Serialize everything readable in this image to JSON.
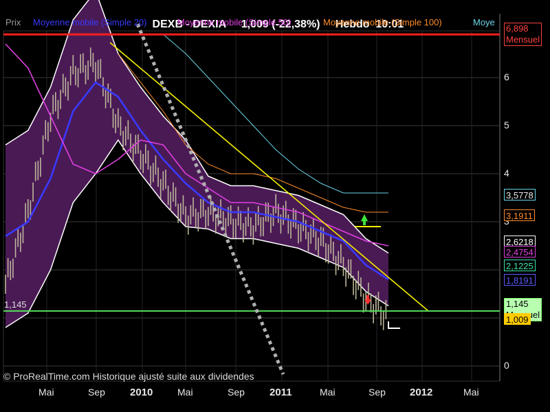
{
  "title": {
    "symbol": "DEXB - DEXIA",
    "price": "1,009 (-22,38%)",
    "period": "Hebdo",
    "time": "10:01"
  },
  "legend": [
    {
      "label": "Prix",
      "color": "#9a9a9a"
    },
    {
      "label": "Moyenne mobile (Simple 20)",
      "color": "#3a3aff"
    },
    {
      "label": "Moyenne mobile (Simple 50)",
      "color": "#e040e0"
    },
    {
      "label": "Moyenne mobile (Simple 100)",
      "color": "#ff8c2a"
    },
    {
      "label": "Moye",
      "color": "#6ad6e8"
    }
  ],
  "y_axis": {
    "ticks": [
      "6",
      "5",
      "4",
      "3",
      "0"
    ]
  },
  "x_axis": {
    "ticks": [
      {
        "label": "Mai",
        "year": false
      },
      {
        "label": "Sep",
        "year": false
      },
      {
        "label": "2010",
        "year": true
      },
      {
        "label": "Mai",
        "year": false
      },
      {
        "label": "Sep",
        "year": false
      },
      {
        "label": "2011",
        "year": true
      },
      {
        "label": "Mai",
        "year": false
      },
      {
        "label": "Sep",
        "year": false
      },
      {
        "label": "2012",
        "year": true
      },
      {
        "label": "Mai",
        "year": false
      }
    ]
  },
  "badges": [
    {
      "value": "6,898",
      "sub": "Mensuel",
      "bg": "#000000",
      "fg": "#ff4040",
      "border": "#ff4040"
    },
    {
      "value": "3,5778",
      "bg": "#000000",
      "fg": "#e8e8e8",
      "border": "#6ad6e8"
    },
    {
      "value": "3,1911",
      "bg": "#000000",
      "fg": "#ff8c2a",
      "border": "#ff8c2a"
    },
    {
      "value": "2,6218",
      "bg": "#000000",
      "fg": "#ffffff",
      "border": "#ffffff"
    },
    {
      "value": "2,4754",
      "bg": "#000000",
      "fg": "#e040e0",
      "border": "#e040e0"
    },
    {
      "value": "2,1225",
      "bg": "#000000",
      "fg": "#3ee6a8",
      "border": "#3ee6a8"
    },
    {
      "value": "1,8191",
      "bg": "#000000",
      "fg": "#5a5aff",
      "border": "#5a5aff"
    },
    {
      "value": "1,145",
      "sub": "Mensuel",
      "bg": "#b8ffb0",
      "fg": "#000000",
      "border": "#7cff6a"
    },
    {
      "value": "1,009",
      "bg": "#ffcc00",
      "fg": "#000000",
      "border": "#ffcc00"
    }
  ],
  "hline_left_label": "1,145",
  "footer": "© ProRealTime.com Historique ajusté suite aux dividendes",
  "chart_data": {
    "type": "line",
    "title": "DEXB - DEXIA",
    "x": [
      "2009-03",
      "2009-05",
      "2009-07",
      "2009-09",
      "2009-11",
      "2010-01",
      "2010-03",
      "2010-05",
      "2010-07",
      "2010-09",
      "2010-11",
      "2011-01",
      "2011-03",
      "2011-05",
      "2011-07",
      "2011-08",
      "2011-09",
      "2011-10"
    ],
    "ylim": [
      0,
      7
    ],
    "series": [
      {
        "name": "Prix",
        "values": [
          1.7,
          3.2,
          5.2,
          6.1,
          6.3,
          5.0,
          4.4,
          3.8,
          3.1,
          3.2,
          3.0,
          2.9,
          3.2,
          2.9,
          2.6,
          2.1,
          1.4,
          1.0
        ]
      },
      {
        "name": "Moyenne mobile (Simple 20)",
        "values": [
          2.7,
          3.0,
          3.9,
          5.3,
          5.9,
          5.6,
          4.9,
          4.3,
          3.8,
          3.4,
          3.2,
          3.2,
          3.1,
          3.0,
          2.8,
          2.6,
          2.1,
          1.8
        ]
      },
      {
        "name": "Moyenne mobile (Simple 50)",
        "values": [
          6.7,
          6.2,
          5.2,
          4.2,
          4.0,
          4.3,
          4.7,
          4.6,
          4.0,
          3.7,
          3.4,
          3.4,
          3.3,
          3.2,
          3.0,
          2.8,
          2.6,
          2.5
        ]
      },
      {
        "name": "Moyenne mobile (Simple 100)",
        "values": [
          null,
          null,
          null,
          null,
          null,
          6.5,
          5.9,
          5.3,
          4.6,
          4.2,
          4.0,
          4.0,
          3.9,
          3.7,
          3.5,
          3.3,
          3.2,
          3.2
        ]
      },
      {
        "name": "Moye",
        "values": [
          null,
          null,
          null,
          null,
          null,
          null,
          null,
          6.9,
          6.5,
          6.0,
          5.5,
          5.0,
          4.5,
          4.1,
          3.8,
          3.6,
          3.6,
          3.6
        ]
      }
    ],
    "hlines": [
      {
        "y": 6.898,
        "label": "Mensuel"
      },
      {
        "y": 1.145,
        "label": "Mensuel"
      }
    ]
  }
}
